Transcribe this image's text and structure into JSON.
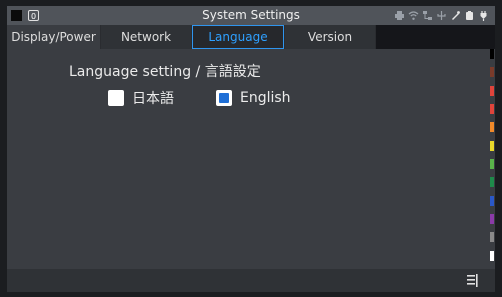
{
  "titlebar": {
    "badge": "0",
    "title": "System Settings",
    "icons": [
      "printer-icon",
      "wifi-icon",
      "network-icon",
      "usb-icon",
      "pen-icon",
      "battery-icon",
      "plug-icon"
    ]
  },
  "tabs": [
    {
      "label": "Display/Power",
      "active": false
    },
    {
      "label": "Network",
      "active": false
    },
    {
      "label": "Language",
      "active": true
    },
    {
      "label": "Version",
      "active": false
    }
  ],
  "language": {
    "section_title": "Language setting / 言語設定",
    "options": [
      {
        "label": "日本語",
        "checked": false
      },
      {
        "label": "English",
        "checked": true
      }
    ]
  },
  "colors": {
    "accent": "#2f95ee",
    "strip": [
      "#000000",
      "#7a3b2a",
      "#e0443b",
      "#e0443b",
      "#f08a2a",
      "#e8d82a",
      "#5ab44a",
      "#1e8a4a",
      "#2a58c8",
      "#8a3aa8",
      "#8a8a8a",
      "#ffffff"
    ]
  },
  "bottombar": {
    "icon": "menu-icon"
  }
}
